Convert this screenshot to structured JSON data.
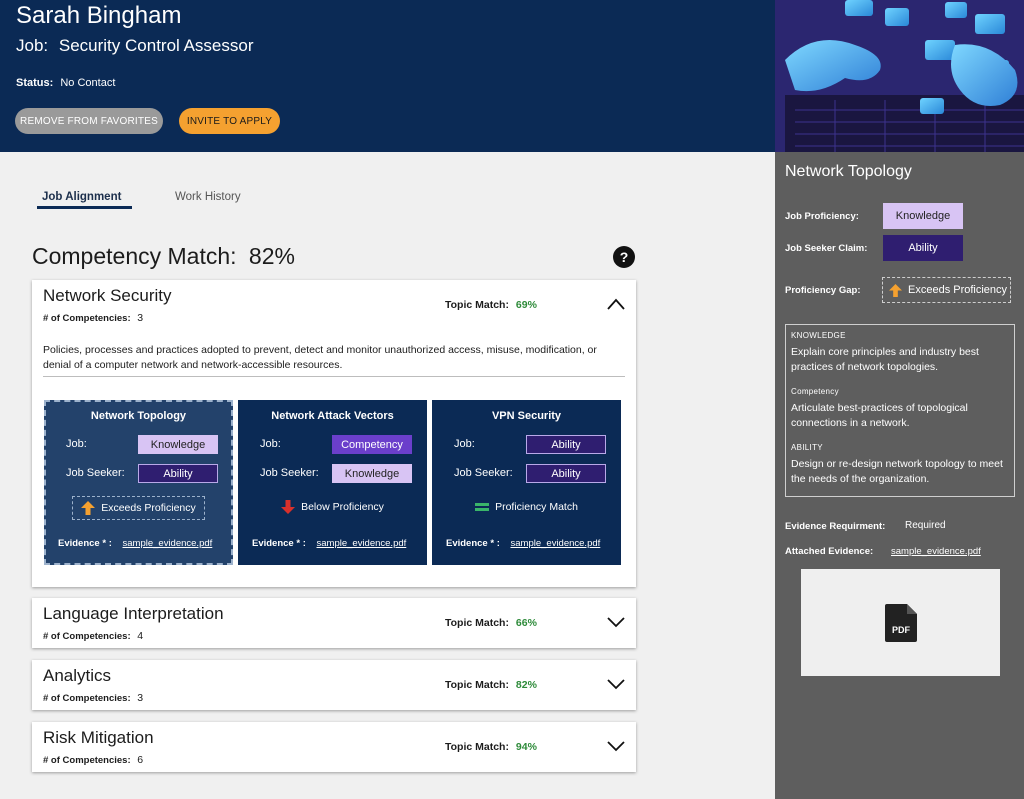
{
  "profile": {
    "name": "Sarah Bingham",
    "job_label": "Job:",
    "job_title": "Security Control Assessor",
    "status_label": "Status:",
    "status_value": "No Contact",
    "remove_button": "REMOVE FROM FAVORITES",
    "invite_button": "INVITE TO APPLY"
  },
  "tabs": [
    {
      "label": "Job Alignment",
      "active": true
    },
    {
      "label": "Work History",
      "active": false
    }
  ],
  "competency_match": {
    "label": "Competency Match:",
    "value": "82%",
    "help": "?"
  },
  "topics": [
    {
      "title": "Network Security",
      "count_label": "# of Competencies:",
      "count": "3",
      "match_label": "Topic Match:",
      "match": "69%",
      "expanded": true,
      "description": "Policies, processes and practices adopted to prevent, detect and monitor unauthorized access, misuse, modification, or denial of a computer network and network-accessible resources.",
      "competencies": [
        {
          "title": "Network Topology",
          "job_label": "Job:",
          "job": "Knowledge",
          "seeker_label": "Job Seeker:",
          "seeker": "Ability",
          "status": "Exceeds Proficiency",
          "status_icon": "arrow-up-icon",
          "evidence_label": "Evidence * :",
          "evidence_file": "sample_evidence.pdf"
        },
        {
          "title": "Network Attack Vectors",
          "job_label": "Job:",
          "job": "Competency",
          "seeker_label": "Job Seeker:",
          "seeker": "Knowledge",
          "status": "Below Proficiency",
          "status_icon": "arrow-down-icon",
          "evidence_label": "Evidence * :",
          "evidence_file": "sample_evidence.pdf"
        },
        {
          "title": "VPN Security",
          "job_label": "Job:",
          "job": "Ability",
          "seeker_label": "Job Seeker:",
          "seeker": "Ability",
          "status": "Proficiency Match",
          "status_icon": "equals-icon",
          "evidence_label": "Evidence * :",
          "evidence_file": "sample_evidence.pdf"
        }
      ]
    },
    {
      "title": "Language Interpretation",
      "count_label": "# of Competencies:",
      "count": "4",
      "match_label": "Topic Match:",
      "match": "66%",
      "expanded": false
    },
    {
      "title": "Analytics",
      "count_label": "# of Competencies:",
      "count": "3",
      "match_label": "Topic Match:",
      "match": "82%",
      "expanded": false
    },
    {
      "title": "Risk Mitigation",
      "count_label": "# of Competencies:",
      "count": "6",
      "match_label": "Topic Match:",
      "match": "94%",
      "expanded": false
    }
  ],
  "detail": {
    "title": "Network Topology",
    "job_prof_label": "Job Proficiency:",
    "job_prof": "Knowledge",
    "seeker_claim_label": "Job Seeker Claim:",
    "seeker_claim": "Ability",
    "gap_label": "Proficiency Gap:",
    "gap": "Exceeds Proficiency",
    "definitions": [
      {
        "heading": "KNOWLEDGE",
        "text": "Explain core principles and industry best practices of network topologies."
      },
      {
        "heading": "Competency",
        "text": "Articulate best-practices of topological connections in a network."
      },
      {
        "heading": "ABILITY",
        "text": "Design or re-design network topology to meet the needs of the organization."
      }
    ],
    "evidence_req_label": "Evidence Requirment:",
    "evidence_req": "Required",
    "attached_label": "Attached Evidence:",
    "attached_file": "sample_evidence.pdf",
    "pdf_label": "PDF"
  },
  "colors": {
    "navy": "#0b2a55",
    "orange": "#f5a130",
    "green_pct": "#2e8b3a",
    "lavender": "#d8c4f4",
    "deep_purple": "#2f1e70",
    "panel_gray": "#5e5e5e"
  }
}
